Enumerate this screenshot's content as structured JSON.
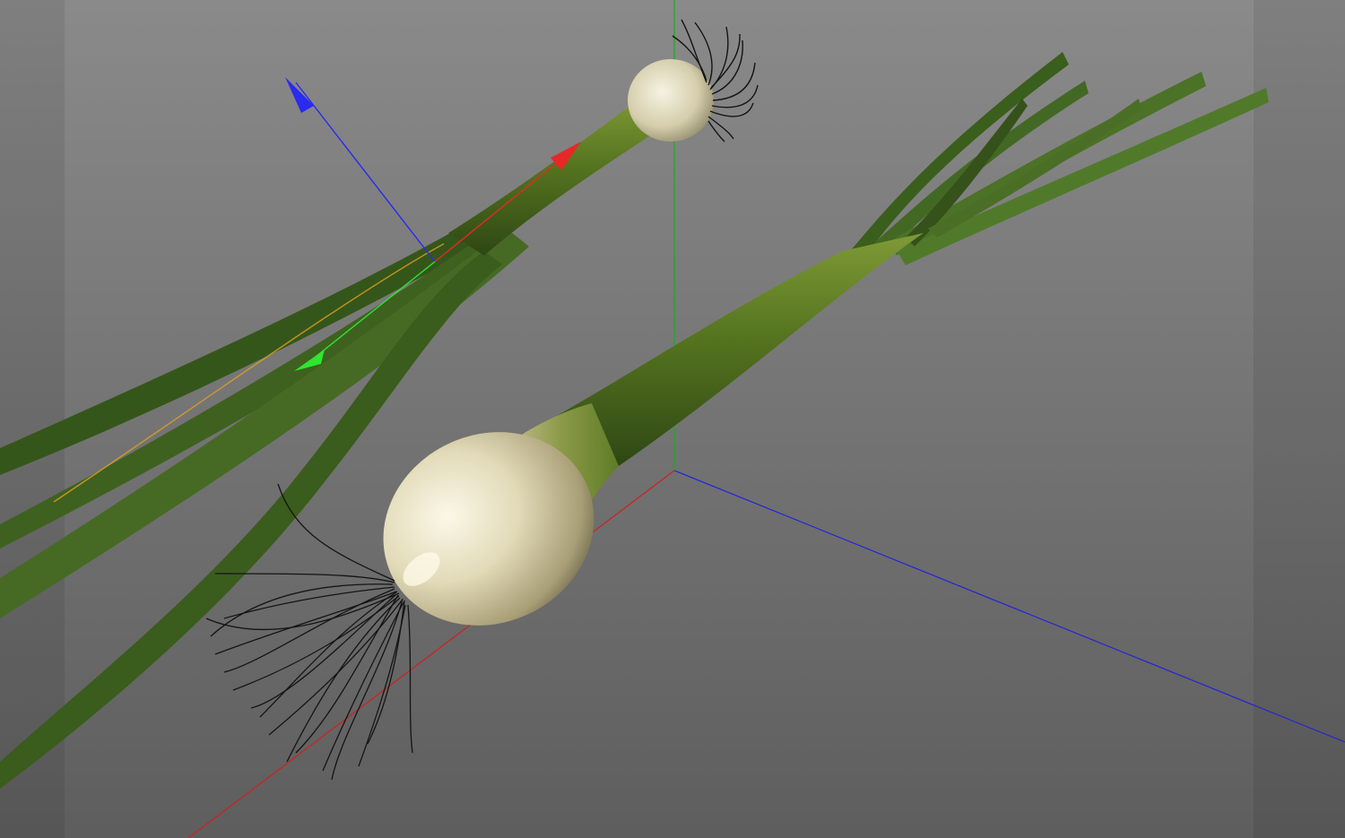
{
  "viewport": {
    "background_top": "#8a8a8a",
    "background_bottom": "#5e5e5e",
    "side_shade": "#6a6a6a"
  },
  "colors": {
    "axis_x": "#d02020",
    "axis_y": "#10b010",
    "axis_z": "#2020d0",
    "gizmo_x": "#e62828",
    "gizmo_y": "#2ee62e",
    "gizmo_z": "#2a2af0",
    "stalk_dark": "#34501a",
    "stalk_mid": "#5a7a26",
    "stalk_light": "#8aa040",
    "bulb_light": "#f4f0dc",
    "bulb_mid": "#cfc6a0",
    "bulb_dark": "#7a7456",
    "roots": "#141414",
    "selection_outline": "#e0a020"
  },
  "objects": {
    "selected_onion": "spring-onion-selected",
    "onion": "spring-onion"
  },
  "icons": {
    "gizmo": "move-gizmo-icon",
    "world_axes": "world-axes-icon"
  }
}
